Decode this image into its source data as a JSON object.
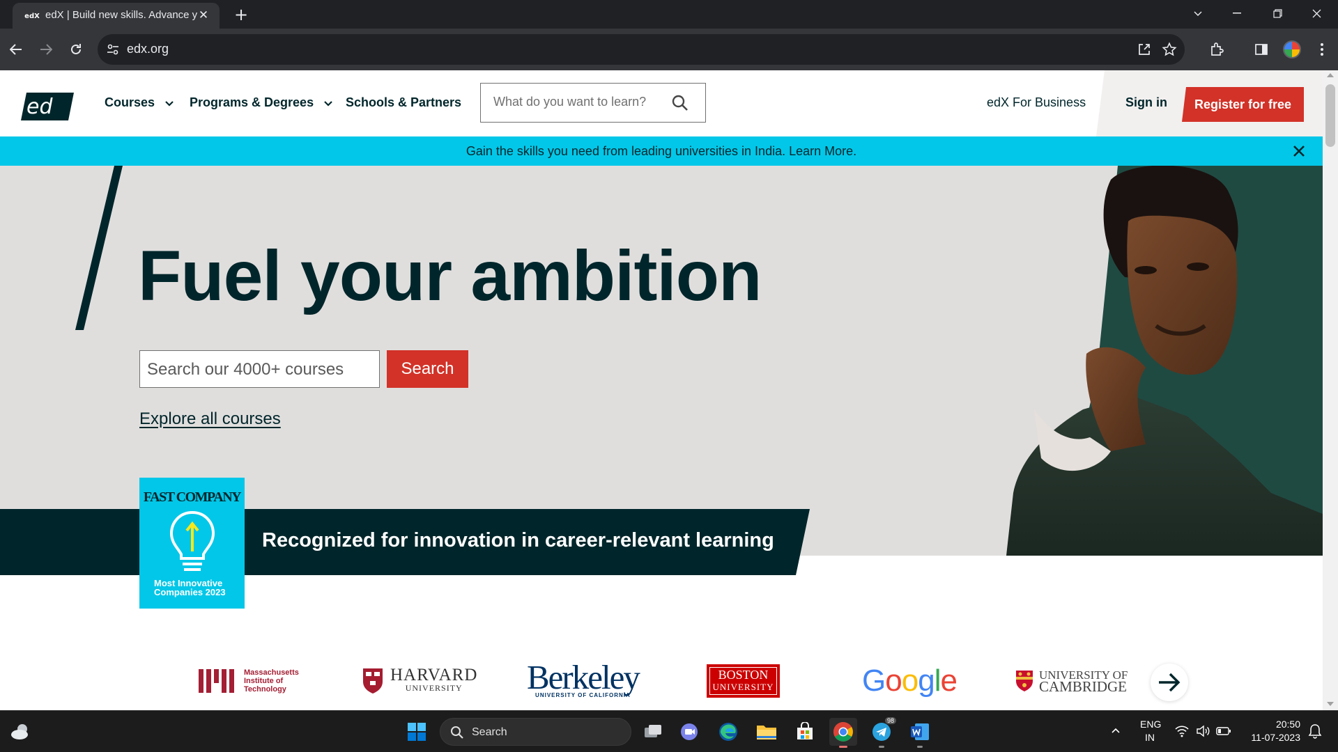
{
  "browser": {
    "tab_favicon": "edX",
    "tab_title": "edX | Build new skills. Advance your career.",
    "url": "edx.org",
    "icons": [
      "back-icon",
      "forward-icon",
      "reload-icon",
      "site-info-icon",
      "share-icon",
      "star-icon",
      "extensions-icon",
      "side-panel-icon",
      "profile-icon",
      "menu-icon"
    ]
  },
  "header": {
    "nav": [
      {
        "label": "Courses"
      },
      {
        "label": "Programs & Degrees"
      },
      {
        "label": "Schools & Partners"
      }
    ],
    "search_placeholder": "What do you want to learn?",
    "business_link": "edX For Business",
    "signin": "Sign in",
    "register": "Register for free"
  },
  "banner": {
    "text": "Gain the skills you need from leading universities in India. Learn More."
  },
  "hero": {
    "title": "Fuel your ambition",
    "search_placeholder": "Search our 4000+ courses",
    "search_button": "Search",
    "explore_link": "Explore all courses"
  },
  "recognition": {
    "text": "Recognized for innovation in career-relevant learning",
    "badge_brand": "FAST COMPANY",
    "badge_line1": "Most Innovative",
    "badge_line2": "Companies 2023"
  },
  "partners": {
    "mit": [
      "Massachusetts",
      "Institute of",
      "Technology"
    ],
    "harvard": {
      "name": "HARVARD",
      "sub": "UNIVERSITY"
    },
    "berkeley": {
      "name": "Berkeley",
      "sub": "UNIVERSITY OF CALIFORNIA"
    },
    "bu": {
      "line1": "BOSTON",
      "line2": "UNIVERSITY"
    },
    "google": [
      "G",
      "o",
      "o",
      "g",
      "l",
      "e"
    ],
    "cambridge": {
      "line1": "UNIVERSITY OF",
      "line2": "CAMBRIDGE"
    }
  },
  "taskbar": {
    "search_label": "Search",
    "telegram_badge": "98",
    "lang": "ENG",
    "region": "IN",
    "time": "20:50",
    "date": "11-07-2023"
  },
  "colors": {
    "primary_dark": "#00262b",
    "accent_red": "#d23228",
    "banner_cyan": "#03c7e8",
    "hero_bg": "#e0dedd"
  }
}
